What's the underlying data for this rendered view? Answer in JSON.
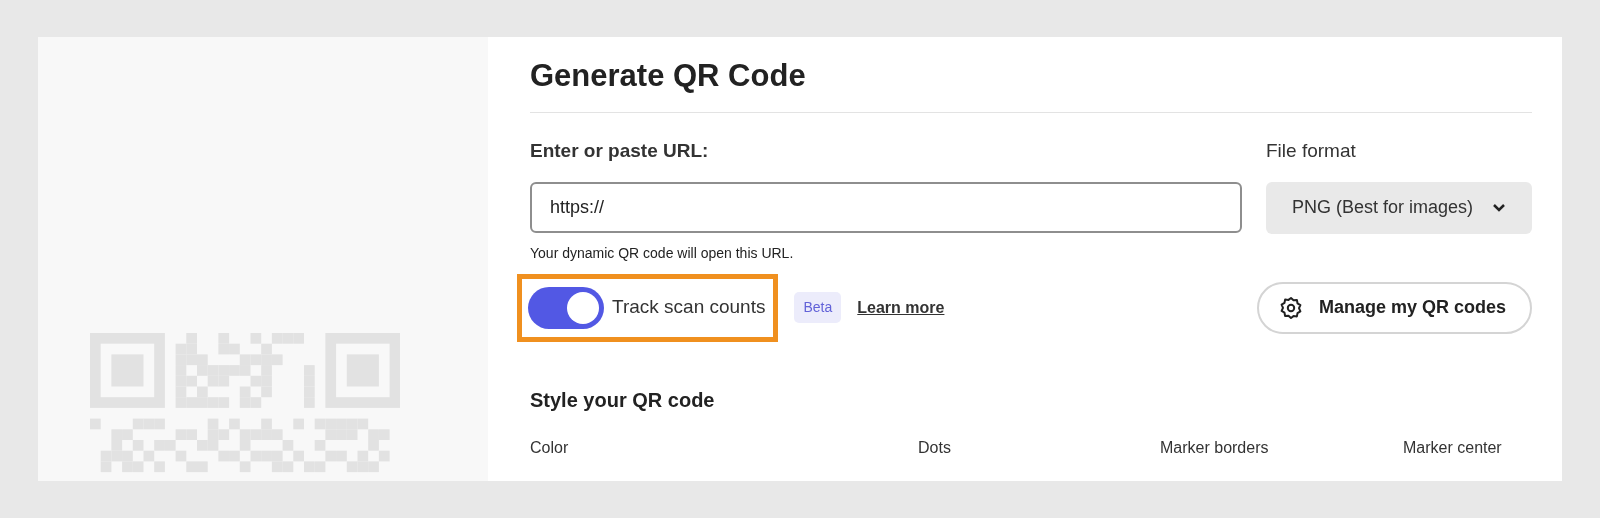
{
  "title": "Generate QR Code",
  "url_field": {
    "label": "Enter or paste URL:",
    "value": "https://",
    "helper": "Your dynamic QR code will open this URL."
  },
  "file_format": {
    "label": "File format",
    "value": "PNG (Best for images)"
  },
  "tracking": {
    "label": "Track scan counts",
    "on": true,
    "highlighted": true,
    "badge": "Beta",
    "link": "Learn more"
  },
  "manage_button": "Manage my QR codes",
  "style_section": {
    "heading": "Style your QR code",
    "columns": [
      "Color",
      "Dots",
      "Marker borders",
      "Marker center"
    ]
  }
}
